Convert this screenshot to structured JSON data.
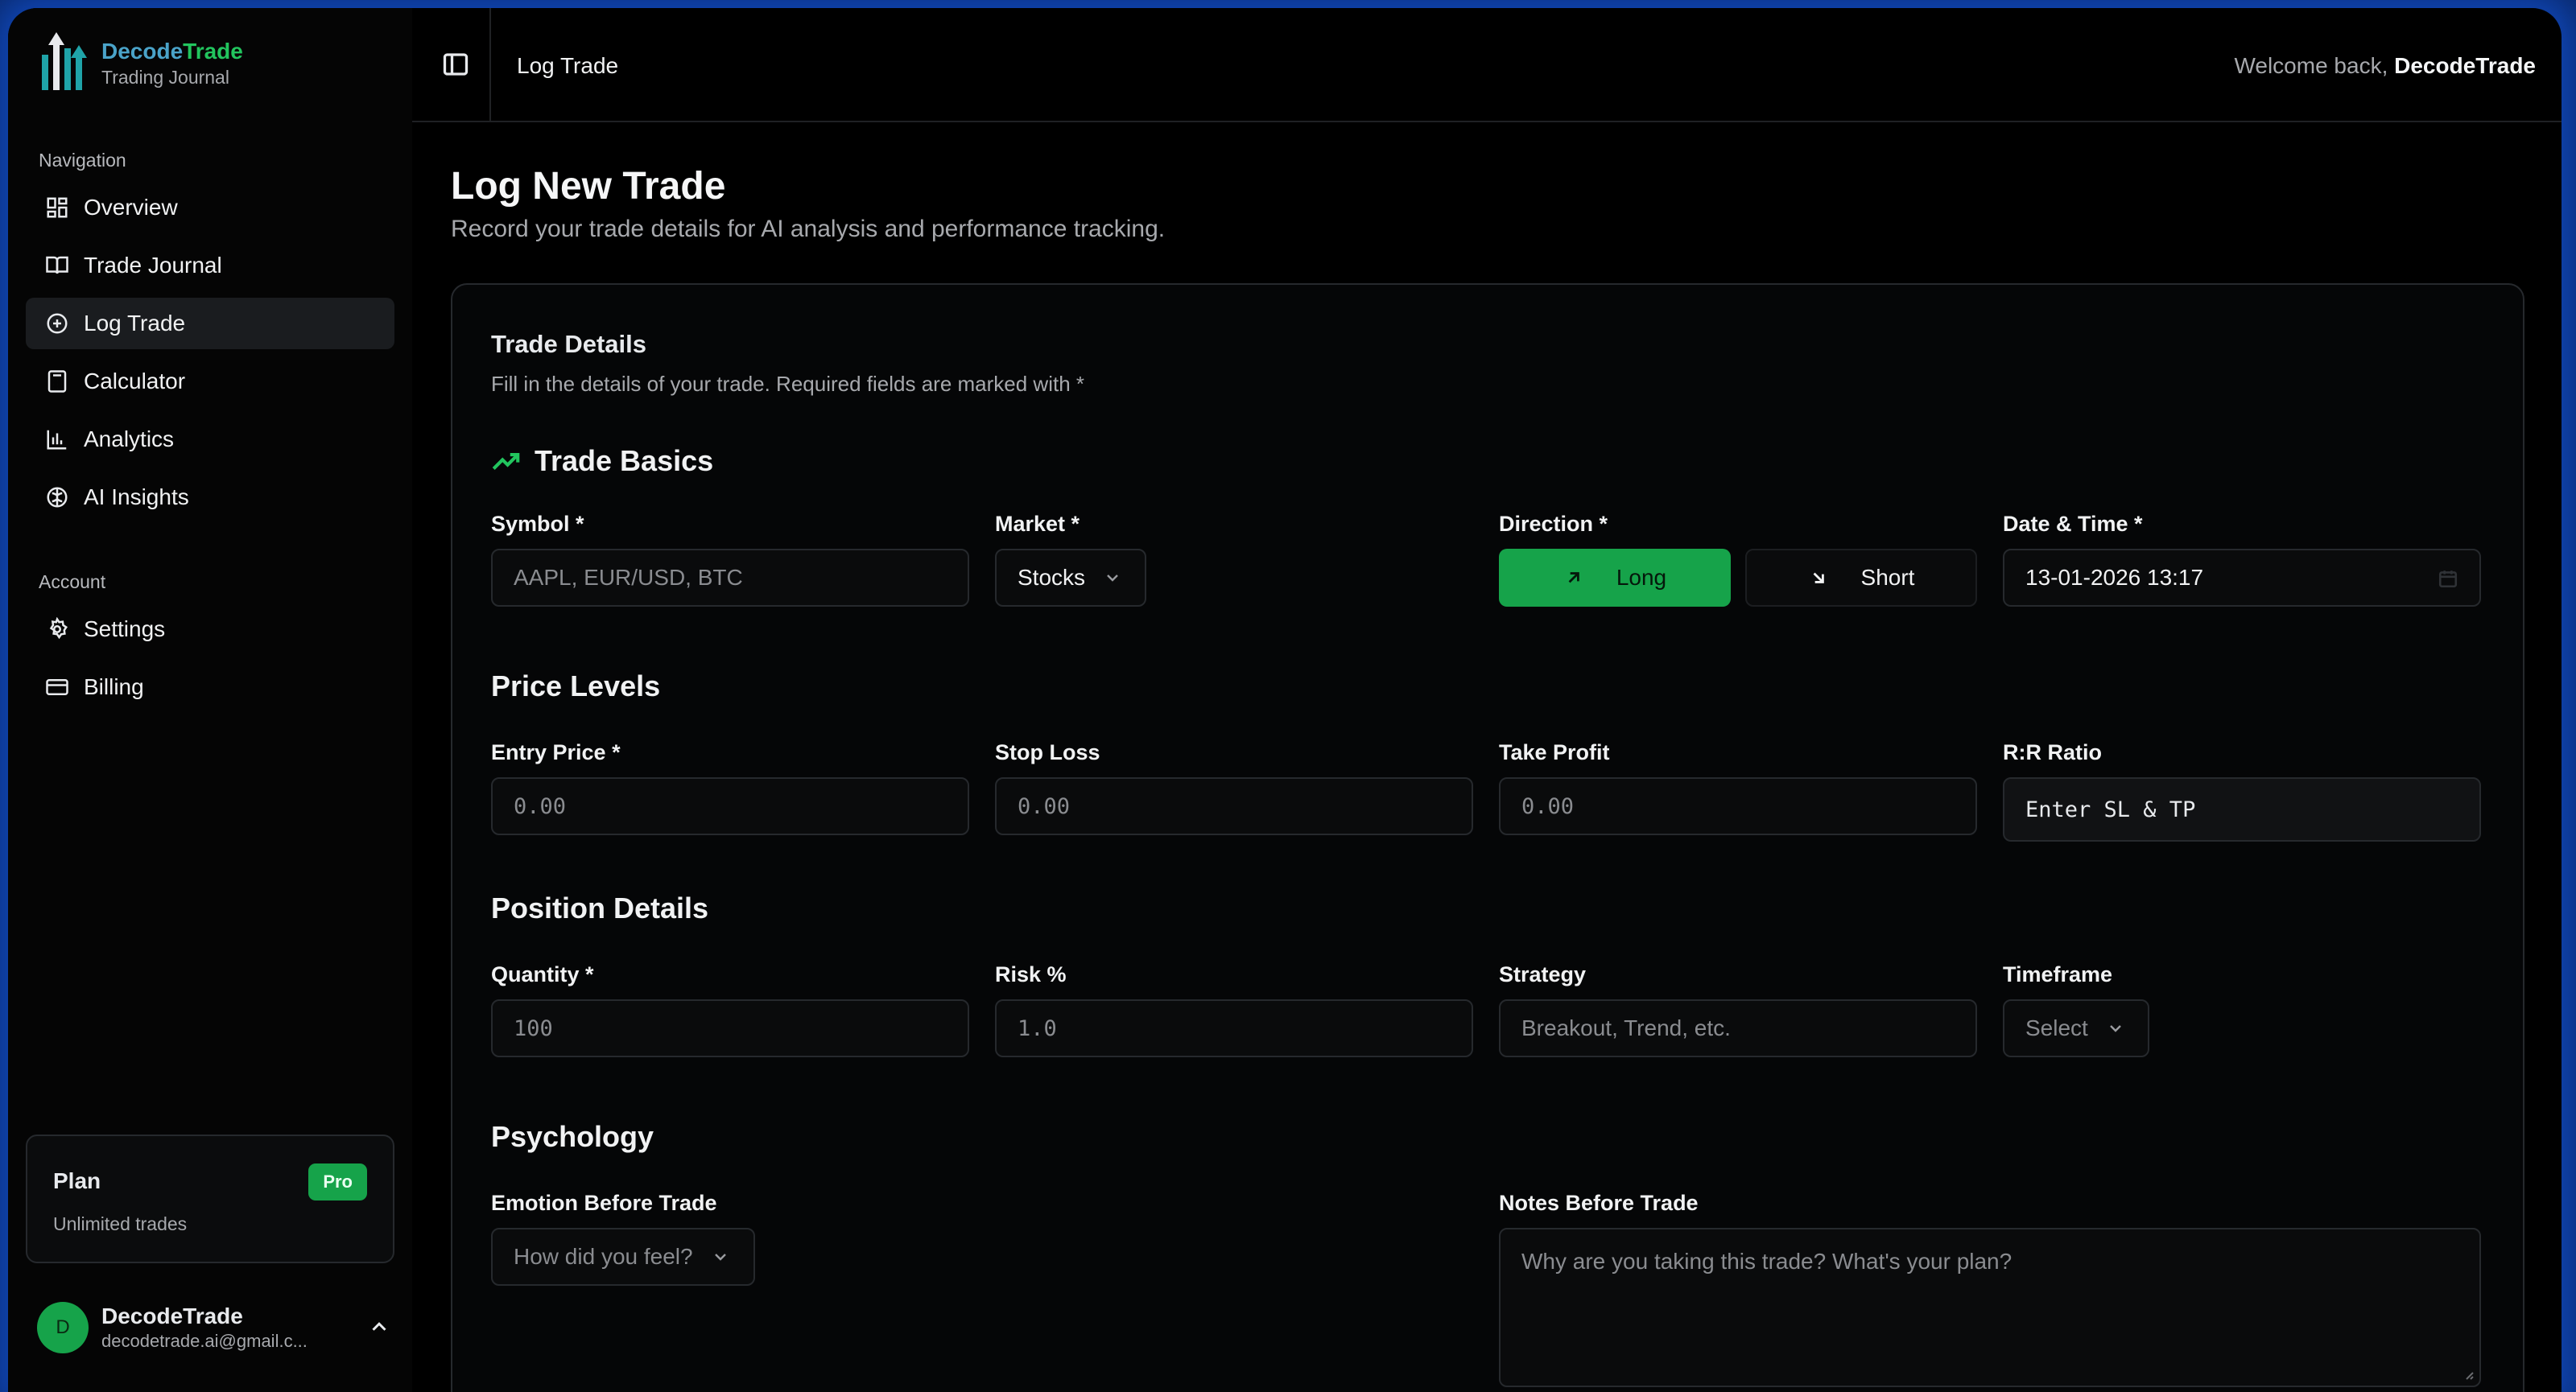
{
  "brand": {
    "name_part1": "Decode",
    "name_part2": "Trade",
    "subtitle": "Trading Journal"
  },
  "sidebar": {
    "nav_heading": "Navigation",
    "nav_items": [
      {
        "label": "Overview",
        "icon": "layout-grid-icon"
      },
      {
        "label": "Trade Journal",
        "icon": "book-open-icon"
      },
      {
        "label": "Log Trade",
        "icon": "plus-circle-icon",
        "active": true
      },
      {
        "label": "Calculator",
        "icon": "calculator-icon"
      },
      {
        "label": "Analytics",
        "icon": "bar-chart-icon"
      },
      {
        "label": "AI Insights",
        "icon": "brain-icon"
      }
    ],
    "account_heading": "Account",
    "account_items": [
      {
        "label": "Settings",
        "icon": "gear-icon"
      },
      {
        "label": "Billing",
        "icon": "credit-card-icon"
      }
    ],
    "plan": {
      "title": "Plan",
      "badge": "Pro",
      "subtitle": "Unlimited trades"
    },
    "user": {
      "initial": "D",
      "name": "DecodeTrade",
      "email": "decodetrade.ai@gmail.c..."
    }
  },
  "topbar": {
    "breadcrumb": "Log Trade",
    "welcome_prefix": "Welcome back, ",
    "welcome_name": "DecodeTrade"
  },
  "page": {
    "title": "Log New Trade",
    "subtitle": "Record your trade details for AI analysis and performance tracking."
  },
  "card": {
    "title": "Trade Details",
    "subtitle": "Fill in the details of your trade. Required fields are marked with *"
  },
  "trade_basics": {
    "heading": "Trade Basics",
    "symbol_label": "Symbol *",
    "symbol_placeholder": "AAPL, EUR/USD, BTC",
    "market_label": "Market *",
    "market_value": "Stocks",
    "direction_label": "Direction *",
    "long_label": "Long",
    "short_label": "Short",
    "selected_direction": "Long",
    "datetime_label": "Date & Time *",
    "datetime_value": "13-01-2026 13:17"
  },
  "price_levels": {
    "heading": "Price Levels",
    "entry_label": "Entry Price *",
    "entry_placeholder": "0.00",
    "stop_label": "Stop Loss",
    "stop_placeholder": "0.00",
    "tp_label": "Take Profit",
    "tp_placeholder": "0.00",
    "rr_label": "R:R Ratio",
    "rr_value": "Enter SL & TP"
  },
  "position_details": {
    "heading": "Position Details",
    "quantity_label": "Quantity *",
    "quantity_placeholder": "100",
    "risk_label": "Risk %",
    "risk_placeholder": "1.0",
    "strategy_label": "Strategy",
    "strategy_placeholder": "Breakout, Trend, etc.",
    "timeframe_label": "Timeframe",
    "timeframe_value": "Select"
  },
  "psychology": {
    "heading": "Psychology",
    "emotion_label": "Emotion Before Trade",
    "emotion_value": "How did you feel?",
    "notes_label": "Notes Before Trade",
    "notes_placeholder": "Why are you taking this trade? What's your plan?"
  },
  "colors": {
    "accent": "#16a34a",
    "brand_blue": "#4aa3c9",
    "background": "#000000",
    "border": "#26292d"
  }
}
